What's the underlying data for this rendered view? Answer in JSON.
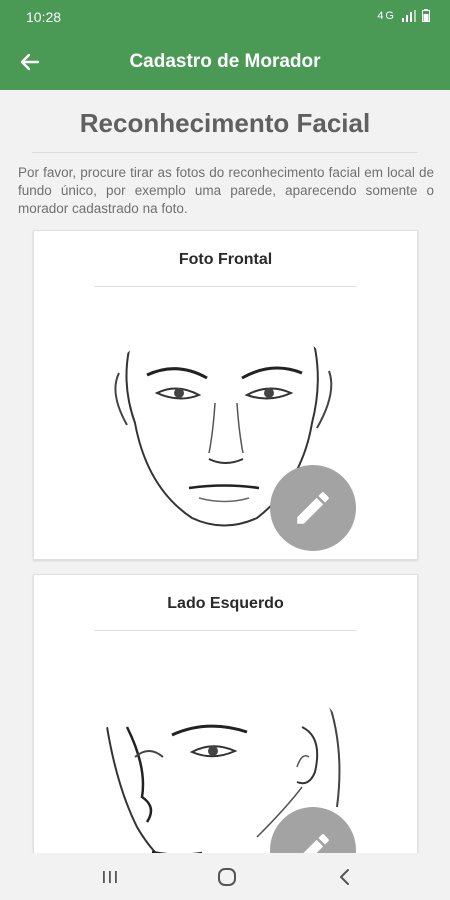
{
  "status_bar": {
    "time": "10:28",
    "network": "4G",
    "icons": [
      "signal-icon",
      "battery-icon"
    ]
  },
  "app_bar": {
    "title": "Cadastro de Morador",
    "back_icon": "arrow-left-icon"
  },
  "page": {
    "title": "Reconhecimento Facial",
    "description": "Por favor, procure tirar as fotos do reconhecimento facial em local de fundo único, por exemplo uma parede, aparecendo somente o morador cadastrado na foto."
  },
  "photos": [
    {
      "label": "Foto Frontal",
      "edit_icon": "pencil-icon"
    },
    {
      "label": "Lado Esquerdo",
      "edit_icon": "pencil-icon"
    }
  ],
  "nav_bar": {
    "icons": [
      "recent-apps-icon",
      "home-icon",
      "back-icon"
    ]
  },
  "colors": {
    "primary": "#4a9a56",
    "edit_button": "#a3a3a3",
    "background": "#f2f2f2"
  }
}
